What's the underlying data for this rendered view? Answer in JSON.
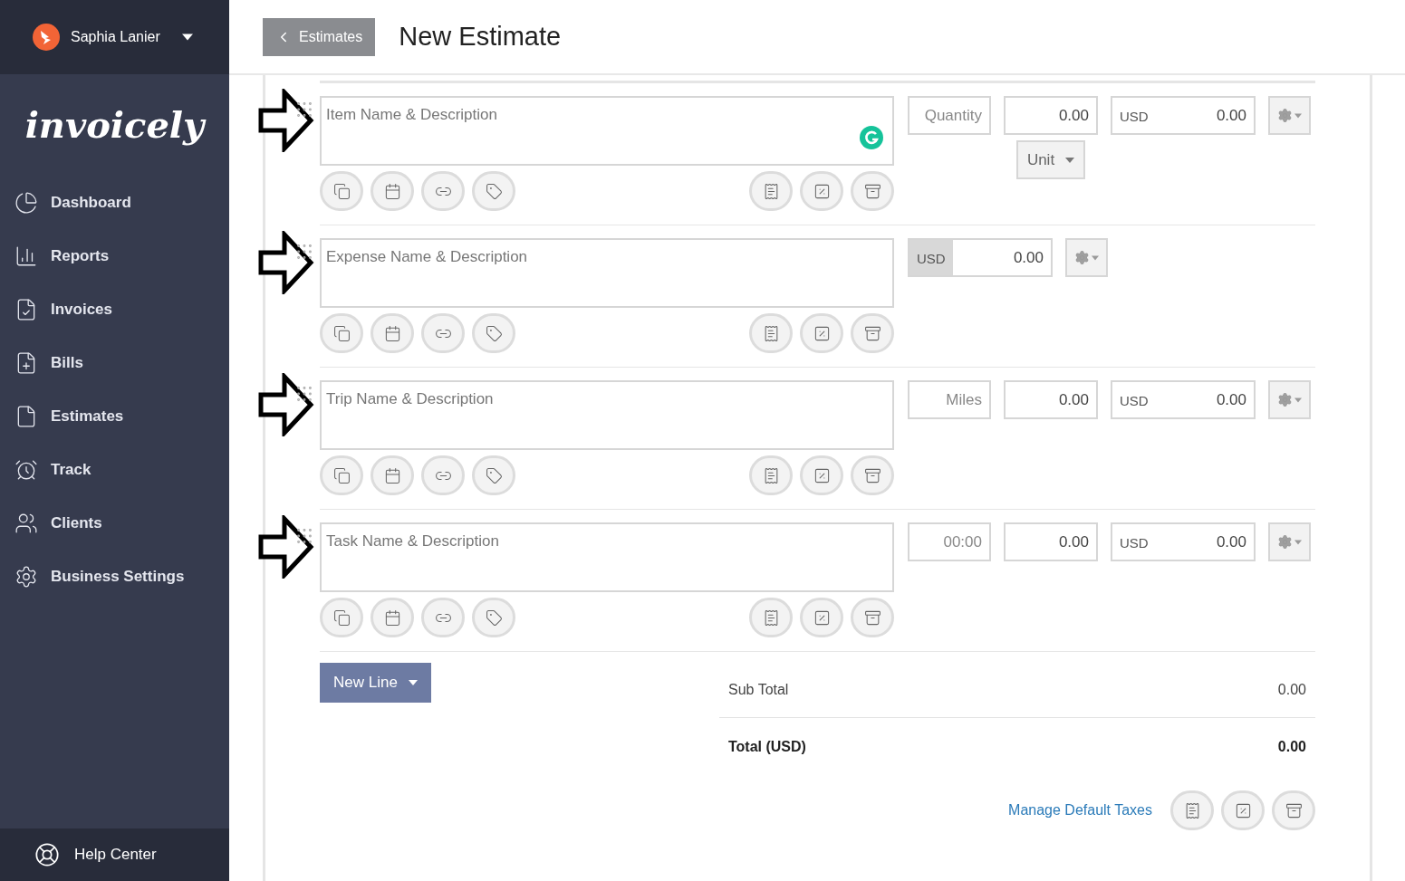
{
  "user": {
    "name": "Saphia Lanier"
  },
  "logo": "invoicely",
  "sidebar": {
    "items": [
      {
        "label": "Dashboard",
        "selected": false
      },
      {
        "label": "Reports",
        "selected": false
      },
      {
        "label": "Invoices",
        "selected": false
      },
      {
        "label": "Bills",
        "selected": false
      },
      {
        "label": "Estimates",
        "selected": false
      },
      {
        "label": "Track",
        "selected": false
      },
      {
        "label": "Clients",
        "selected": false
      },
      {
        "label": "Business Settings",
        "selected": false
      }
    ],
    "help": "Help Center"
  },
  "header": {
    "back": "Estimates",
    "title": "New Estimate"
  },
  "lines": [
    {
      "kind": "item",
      "placeholder": "Item Name & Description",
      "qty_placeholder": "Quantity",
      "rate": "0.00",
      "unit": "Unit",
      "currency": "USD",
      "amount": "0.00",
      "grammarly": true
    },
    {
      "kind": "expense",
      "placeholder": "Expense Name & Description",
      "currency": "USD",
      "amount": "0.00",
      "grammarly": false
    },
    {
      "kind": "trip",
      "placeholder": "Trip Name & Description",
      "qty_placeholder": "Miles",
      "rate": "0.00",
      "currency": "USD",
      "amount": "0.00",
      "grammarly": false
    },
    {
      "kind": "task",
      "placeholder": "Task Name & Description",
      "qty_placeholder": "00:00",
      "rate": "0.00",
      "currency": "USD",
      "amount": "0.00",
      "grammarly": false
    }
  ],
  "new_line": "New Line",
  "totals": {
    "subtotal_label": "Sub Total",
    "subtotal": "0.00",
    "total_label": "Total (USD)",
    "total": "0.00"
  },
  "manage_taxes": "Manage Default Taxes"
}
